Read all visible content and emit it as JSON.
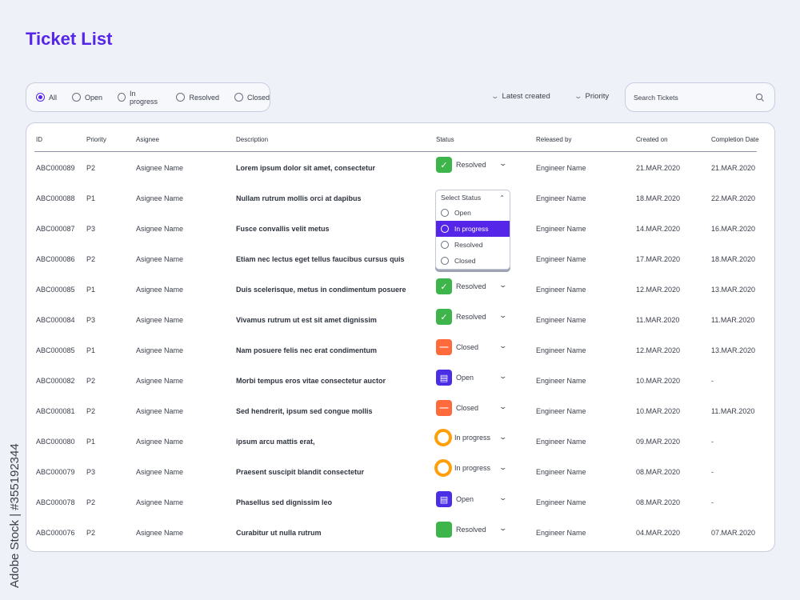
{
  "header": {
    "title": "Ticket List"
  },
  "filters": {
    "options": [
      "All",
      "Open",
      "In progress",
      "Resolved",
      "Closed"
    ],
    "selected": "All"
  },
  "sort": {
    "latest_label": "Latest created",
    "priority_label": "Priority"
  },
  "search": {
    "placeholder": "Search Tickets"
  },
  "table": {
    "columns": [
      "ID",
      "Priority",
      "Asignee",
      "Description",
      "Status",
      "Released by",
      "Created on",
      "Completion Date"
    ],
    "rows": [
      {
        "id": "ABC000089",
        "priority": "P2",
        "assignee": "Asignee Name",
        "description": "Lorem ipsum dolor sit amet, consectetur",
        "status": "Resolved",
        "released_by": "Engineer Name",
        "created_on": "21.MAR.2020",
        "completion": "21.MAR.2020"
      },
      {
        "id": "ABC000088",
        "priority": "P1",
        "assignee": "Asignee Name",
        "description": "Nullam rutrum mollis orci at dapibus",
        "status": "",
        "released_by": "Engineer Name",
        "created_on": "18.MAR.2020",
        "completion": "22.MAR.2020"
      },
      {
        "id": "ABC000087",
        "priority": "P3",
        "assignee": "Asignee Name",
        "description": "Fusce convallis velit metus",
        "status": "",
        "released_by": "Engineer Name",
        "created_on": "14.MAR.2020",
        "completion": "16.MAR.2020"
      },
      {
        "id": "ABC000086",
        "priority": "P2",
        "assignee": "Asignee Name",
        "description": "Etiam nec lectus eget tellus faucibus cursus quis",
        "status": "",
        "released_by": "Engineer Name",
        "created_on": "17.MAR.2020",
        "completion": "18.MAR.2020"
      },
      {
        "id": "ABC000085",
        "priority": "P1",
        "assignee": "Asignee Name",
        "description": "Duis scelerisque, metus in condimentum posuere",
        "status": "Resolved",
        "released_by": "Engineer Name",
        "created_on": "12.MAR.2020",
        "completion": "13.MAR.2020"
      },
      {
        "id": "ABC000084",
        "priority": "P3",
        "assignee": "Asignee Name",
        "description": "Vivamus rutrum ut est sit amet dignissim",
        "status": "Resolved",
        "released_by": "Engineer Name",
        "created_on": "11.MAR.2020",
        "completion": "11.MAR.2020"
      },
      {
        "id": "ABC000085",
        "priority": "P1",
        "assignee": "Asignee Name",
        "description": "Nam posuere felis nec erat condimentum",
        "status": "Closed",
        "released_by": "Engineer Name",
        "created_on": "12.MAR.2020",
        "completion": "13.MAR.2020"
      },
      {
        "id": "ABC000082",
        "priority": "P2",
        "assignee": "Asignee Name",
        "description": "Morbi tempus eros vitae consectetur auctor",
        "status": "Open",
        "released_by": "Engineer Name",
        "created_on": "10.MAR.2020",
        "completion": "-"
      },
      {
        "id": "ABC000081",
        "priority": "P2",
        "assignee": "Asignee Name",
        "description": "Sed hendrerit, ipsum sed congue mollis",
        "status": "Closed",
        "released_by": "Engineer Name",
        "created_on": "10.MAR.2020",
        "completion": "11.MAR.2020"
      },
      {
        "id": "ABC000080",
        "priority": "P1",
        "assignee": "Asignee Name",
        "description": "ipsum arcu mattis erat,",
        "status": "In progress",
        "released_by": "Engineer Name",
        "created_on": "09.MAR.2020",
        "completion": "-"
      },
      {
        "id": "ABC000079",
        "priority": "P3",
        "assignee": "Asignee Name",
        "description": "Praesent suscipit blandit consectetur",
        "status": "In progress",
        "released_by": "Engineer Name",
        "created_on": "08.MAR.2020",
        "completion": "-"
      },
      {
        "id": "ABC000078",
        "priority": "P2",
        "assignee": "Asignee Name",
        "description": "Phasellus sed dignissim leo",
        "status": "Open",
        "released_by": "Engineer Name",
        "created_on": "08.MAR.2020",
        "completion": "-"
      },
      {
        "id": "ABC000076",
        "priority": "P2",
        "assignee": "Asignee Name",
        "description": "Curabitur ut nulla rutrum",
        "status": "Resolved",
        "released_by": "Engineer Name",
        "created_on": "04.MAR.2020",
        "completion": "07.MAR.2020"
      }
    ]
  },
  "status_dropdown": {
    "title": "Select Status",
    "options": [
      "Open",
      "In progress",
      "Resolved",
      "Closed"
    ],
    "highlighted": "In progress"
  },
  "status_colors": {
    "Resolved": "#3db54a",
    "Closed": "#ff6a3d",
    "Open": "#4a2ee6",
    "In progress": "#ff9f0a",
    "accent": "#5526e8"
  },
  "watermark": "Adobe Stock | #355192344"
}
